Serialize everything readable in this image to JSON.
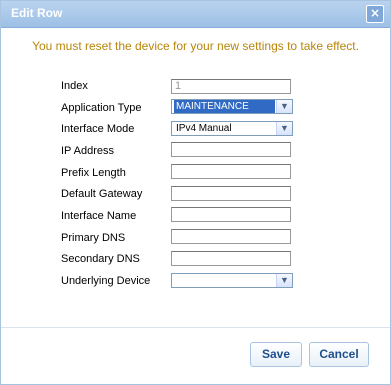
{
  "dialog": {
    "title": "Edit Row",
    "close_glyph": "×",
    "notice": "You must reset the device for your new settings to take effect.",
    "notice_color": "#b8860b"
  },
  "form": {
    "index": {
      "label": "Index",
      "value": "1"
    },
    "application_type": {
      "label": "Application Type",
      "value": "MAINTENANCE"
    },
    "interface_mode": {
      "label": "Interface Mode",
      "value": "IPv4 Manual"
    },
    "ip_address": {
      "label": "IP Address",
      "value": ""
    },
    "prefix_length": {
      "label": "Prefix Length",
      "value": ""
    },
    "default_gateway": {
      "label": "Default Gateway",
      "value": ""
    },
    "interface_name": {
      "label": "Interface Name",
      "value": ""
    },
    "primary_dns": {
      "label": "Primary DNS",
      "value": ""
    },
    "secondary_dns": {
      "label": "Secondary DNS",
      "value": ""
    },
    "underlying_device": {
      "label": "Underlying Device",
      "value": ""
    }
  },
  "buttons": {
    "save_label": "Save",
    "cancel_label": "Cancel"
  },
  "icons": {
    "dropdown_arrow": "chevron-down-icon",
    "close": "close-icon"
  }
}
